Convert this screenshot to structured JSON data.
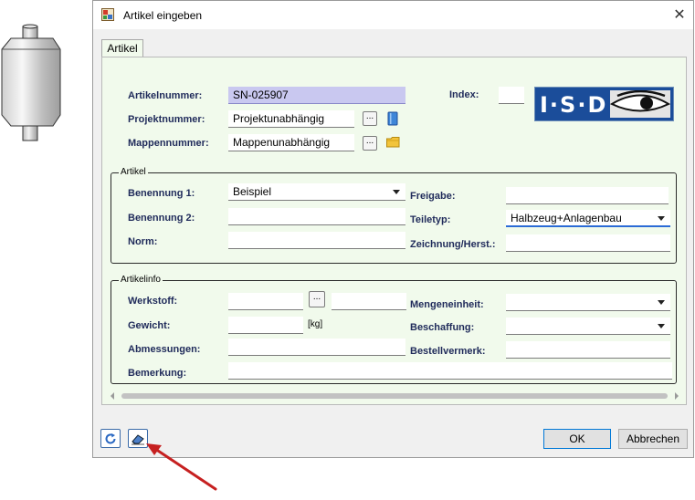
{
  "window": {
    "title": "Artikel eingeben",
    "close_glyph": "✕"
  },
  "tab": {
    "label": "Artikel"
  },
  "header": {
    "artikelnummer_label": "Artikelnummer:",
    "artikelnummer_value": "SN-025907",
    "projektnummer_label": "Projektnummer:",
    "projektnummer_value": "Projektunabhängig",
    "mappennummer_label": "Mappennummer:",
    "mappennummer_value": "Mappenunabhängig",
    "index_label": "Index:",
    "index_value": "",
    "browse_glyph": "...",
    "logo_text": "I·S·D"
  },
  "artikel_group": {
    "title": "Artikel",
    "benennung1_label": "Benennung 1:",
    "benennung1_value": "Beispiel",
    "benennung2_label": "Benennung 2:",
    "benennung2_value": "",
    "norm_label": "Norm:",
    "norm_value": "",
    "freigabe_label": "Freigabe:",
    "freigabe_value": "",
    "teiletyp_label": "Teiletyp:",
    "teiletyp_value": "Halbzeug+Anlagenbau",
    "zeichnung_label": "Zeichnung/Herst.:",
    "zeichnung_value": ""
  },
  "artikelinfo_group": {
    "title": "Artikelinfo",
    "werkstoff_label": "Werkstoff:",
    "werkstoff_value": "",
    "gewicht_label": "Gewicht:",
    "gewicht_value": "",
    "gewicht_unit": "[kg]",
    "abmessungen_label": "Abmessungen:",
    "abmessungen_value": "",
    "bemerkung_label": "Bemerkung:",
    "bemerkung_value": "",
    "mengeneinheit_label": "Mengeneinheit:",
    "mengeneinheit_value": "",
    "beschaffung_label": "Beschaffung:",
    "beschaffung_value": "",
    "bestellvermerk_label": "Bestellvermerk:",
    "bestellvermerk_value": ""
  },
  "footer": {
    "ok_label": "OK",
    "cancel_label": "Abbrechen"
  },
  "colors": {
    "panel_bg": "#f1faec",
    "article_field_bg": "#c9c8f0",
    "logo_bg": "#1b4d9a",
    "focus_border": "#2b6bd6",
    "arrow": "#cc1f1f"
  }
}
